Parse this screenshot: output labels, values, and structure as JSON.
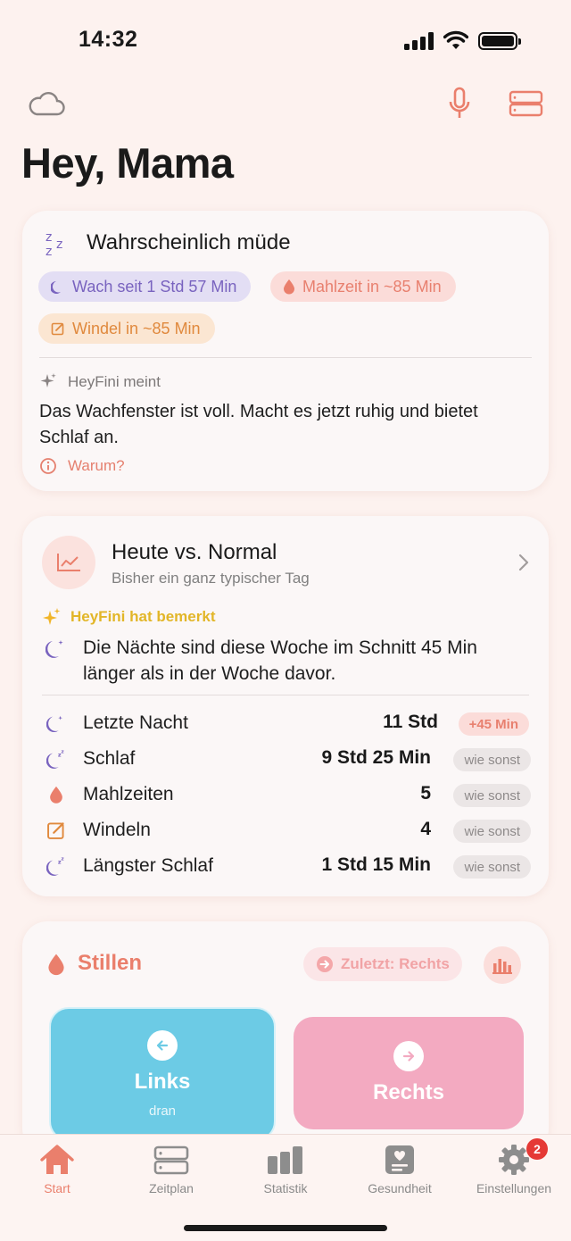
{
  "status": {
    "time": "14:32"
  },
  "header": {
    "title": "Hey, Mama"
  },
  "state_card": {
    "title": "Wahrscheinlich müde",
    "chips": {
      "wake": "Wach seit 1 Std 57 Min",
      "meal": "Mahlzeit in ~85 Min",
      "diaper": "Windel in ~85 Min"
    },
    "meint_label": "HeyFini meint",
    "meint_text": "Das Wachfenster ist voll. Macht es jetzt ruhig und bietet Schlaf an.",
    "why_label": "Warum?"
  },
  "compare_card": {
    "title": "Heute vs. Normal",
    "subtitle": "Bisher ein ganz typischer Tag",
    "noticed_label": "HeyFini hat bemerkt",
    "noticed_text": "Die Nächte sind diese Woche im Schnitt 45 Min länger als in der Woche davor.",
    "rows": [
      {
        "label": "Letzte Nacht",
        "value": "11 Std",
        "badge": "+45 Min",
        "icon": "moon-stars-icon"
      },
      {
        "label": "Schlaf",
        "value": "9 Std 25 Min",
        "badge": "wie sonst",
        "icon": "moon-zz-icon"
      },
      {
        "label": "Mahlzeiten",
        "value": "5",
        "badge": "wie sonst",
        "icon": "drop-icon"
      },
      {
        "label": "Windeln",
        "value": "4",
        "badge": "wie sonst",
        "icon": "note-edit-icon"
      },
      {
        "label": "Längster Schlaf",
        "value": "1 Std 15 Min",
        "badge": "wie sonst",
        "icon": "moon-zz-icon"
      }
    ]
  },
  "feeding_card": {
    "title": "Stillen",
    "last_chip": "Zuletzt: Rechts",
    "left_label": "Links",
    "left_sub": "dran",
    "right_label": "Rechts"
  },
  "tabbar": {
    "tabs": [
      {
        "label": "Start",
        "icon": "home-icon",
        "active": true
      },
      {
        "label": "Zeitplan",
        "icon": "schedule-icon"
      },
      {
        "label": "Statistik",
        "icon": "bar-chart-icon"
      },
      {
        "label": "Gesundheit",
        "icon": "health-icon"
      },
      {
        "label": "Einstellungen",
        "icon": "gear-icon",
        "badge": "2"
      }
    ]
  },
  "colors": {
    "accent": "#ea7f6c",
    "purple": "#7963bf",
    "background": "#fdf2ef"
  }
}
